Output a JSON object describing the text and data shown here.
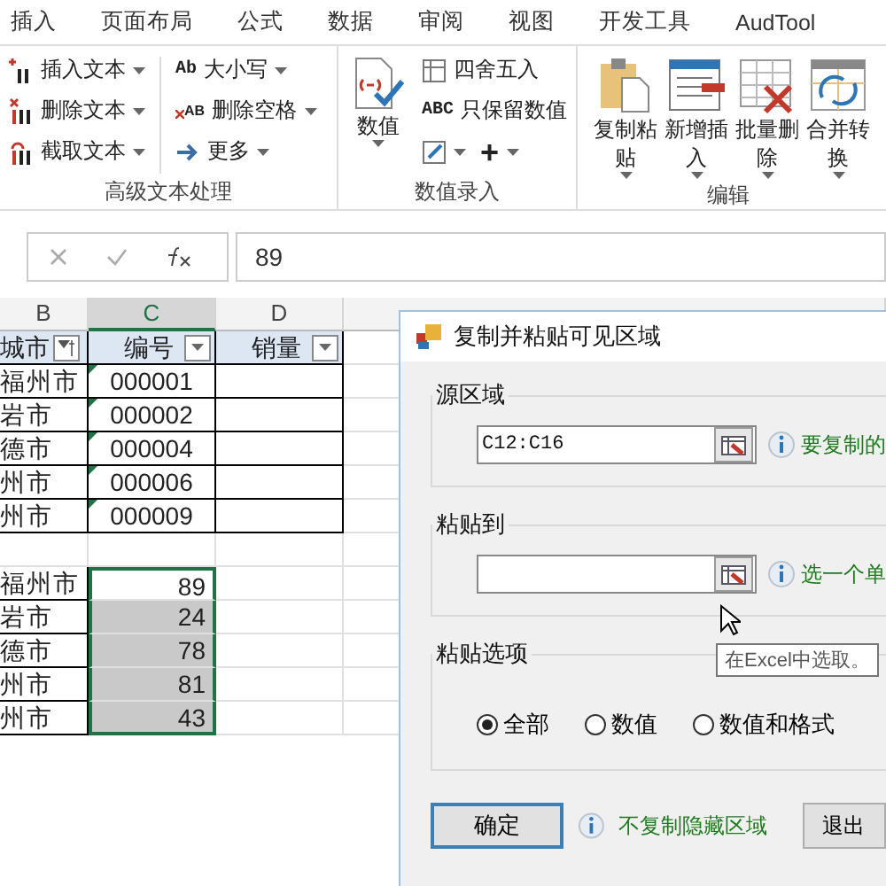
{
  "tabs": [
    {
      "label": "插入",
      "selected": false
    },
    {
      "label": "页面布局",
      "selected": false
    },
    {
      "label": "公式",
      "selected": false
    },
    {
      "label": "数据",
      "selected": false
    },
    {
      "label": "审阅",
      "selected": false
    },
    {
      "label": "视图",
      "selected": false
    },
    {
      "label": "开发工具",
      "selected": false
    },
    {
      "label": "AudTool",
      "selected": false
    }
  ],
  "ribbon": {
    "groups": [
      {
        "label": "高级文本处理",
        "kind": "text",
        "columns": [
          [
            {
              "label": "插入文本"
            },
            {
              "label": "删除文本"
            },
            {
              "label": "截取文本"
            }
          ],
          [
            {
              "label": "大小写",
              "glyph": "Ab"
            },
            {
              "label": "删除空格",
              "glyph": "AB"
            },
            {
              "label": "更多"
            }
          ]
        ]
      },
      {
        "label": "数值录入",
        "kind": "number",
        "big": {
          "label": "数值"
        },
        "small": [
          {
            "label": "四舍五入"
          },
          {
            "label": "只保留数值",
            "glyph": "ABC"
          }
        ],
        "extras": [
          {
            "kind": "icon"
          },
          {
            "kind": "text",
            "label": "+"
          }
        ]
      },
      {
        "label": "编辑",
        "kind": "large",
        "buttons": [
          {
            "label": "复制粘贴"
          },
          {
            "label": "新增插入"
          },
          {
            "label": "批量删除"
          },
          {
            "label": "合并转换"
          }
        ]
      }
    ]
  },
  "formula_bar": {
    "value": "89"
  },
  "sheet": {
    "columns": [
      {
        "letter": "B",
        "selected": false
      },
      {
        "letter": "C",
        "selected": true
      },
      {
        "letter": "D",
        "selected": false
      }
    ],
    "header": [
      {
        "text": "城市",
        "filtered": true
      },
      {
        "text": "编号",
        "filtered": false
      },
      {
        "text": "销量",
        "filtered": false
      }
    ],
    "rows": [
      {
        "city": "福州市",
        "code": "000001",
        "flagged": true
      },
      {
        "city": "岩市",
        "code": "000002",
        "flagged": true
      },
      {
        "city": "德市",
        "code": "000004",
        "flagged": true
      },
      {
        "city": "州市",
        "code": "000006",
        "flagged": true
      },
      {
        "city": "州市",
        "code": "000009",
        "flagged": true
      }
    ],
    "values": [
      {
        "city": "福州市",
        "value": "89",
        "selected": true,
        "active": true
      },
      {
        "city": "岩市",
        "value": "24",
        "selected": true,
        "active": false
      },
      {
        "city": "德市",
        "value": "78",
        "selected": true,
        "active": false
      },
      {
        "city": "州市",
        "value": "81",
        "selected": true,
        "active": false
      },
      {
        "city": "州市",
        "value": "43",
        "selected": true,
        "active": false
      }
    ]
  },
  "dialog": {
    "title": "复制并粘贴可见区域",
    "source": {
      "legend": "源区域",
      "value": "C12:C16",
      "hint": "要复制的"
    },
    "target": {
      "legend": "粘贴到",
      "hint": "选一个单"
    },
    "tooltip": "在Excel中选取。",
    "options": {
      "legend": "粘贴选项",
      "radios": [
        {
          "label": "全部",
          "selected": true
        },
        {
          "label": "数值",
          "selected": false
        },
        {
          "label": "数值和格式",
          "selected": false
        }
      ]
    },
    "ok": "确定",
    "note": "不复制隐藏区域",
    "exit": "退出"
  }
}
